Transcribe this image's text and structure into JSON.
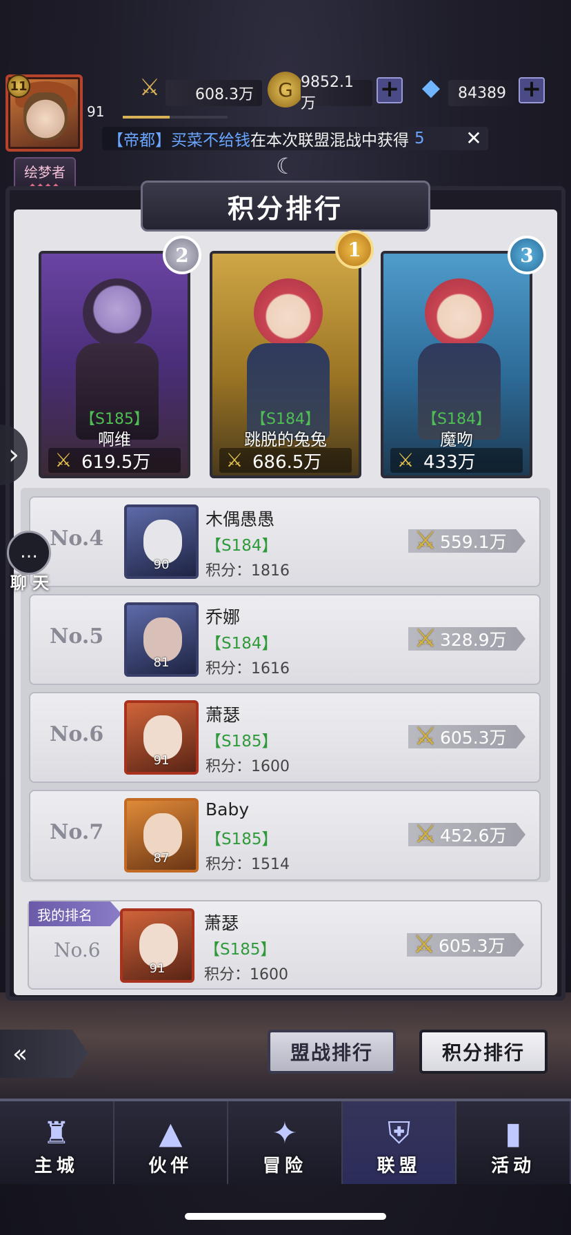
{
  "player": {
    "level_badge": "11",
    "level": "91",
    "title": "绘梦者",
    "title_gems": "◆◆◆◆"
  },
  "resources": {
    "power": "608.3万",
    "gold": "9852.1万",
    "diamonds": "84389"
  },
  "ticker": {
    "server": "【帝都】",
    "player": "买菜不给钱",
    "message": "在本次联盟混战中获得",
    "value": "5"
  },
  "panel": {
    "title": "积分排行"
  },
  "podium": [
    {
      "rank": "2",
      "server": "【S185】",
      "name": "啊维",
      "power": "619.5万"
    },
    {
      "rank": "1",
      "server": "【S184】",
      "name": "跳脱的兔兔",
      "power": "686.5万"
    },
    {
      "rank": "3",
      "server": "【S184】",
      "name": "魔吻",
      "power": "433万"
    }
  ],
  "rows": [
    {
      "rank": "No.4",
      "name": "木偶愚愚",
      "server": "【S184】",
      "score": "积分：1816",
      "power": "559.1万",
      "level": "90"
    },
    {
      "rank": "No.5",
      "name": "乔娜",
      "server": "【S184】",
      "score": "积分：1616",
      "power": "328.9万",
      "level": "81"
    },
    {
      "rank": "No.6",
      "name": "萧瑟",
      "server": "【S185】",
      "score": "积分：1600",
      "power": "605.3万",
      "level": "91"
    },
    {
      "rank": "No.7",
      "name": "Baby",
      "server": "【S185】",
      "score": "积分：1514",
      "power": "452.6万",
      "level": "87"
    }
  ],
  "my_rank": {
    "tag": "我的排名",
    "rank": "No.6",
    "name": "萧瑟",
    "server": "【S185】",
    "score": "积分：1600",
    "power": "605.3万",
    "level": "91"
  },
  "side": {
    "chat_label": "聊 天"
  },
  "tabs": {
    "battle_rank": "盟战排行",
    "score_rank": "积分排行"
  },
  "nav": [
    {
      "label": "主城",
      "icon": "castle-icon"
    },
    {
      "label": "伙伴",
      "icon": "witch-hat-icon"
    },
    {
      "label": "冒险",
      "icon": "compass-icon"
    },
    {
      "label": "联盟",
      "icon": "shield-icon"
    },
    {
      "label": "活动",
      "icon": "cards-icon"
    }
  ],
  "colors": {
    "server_green": "#2f9a3a",
    "gold_accent": "#d6b43e",
    "active_nav": "#2c2c5a"
  }
}
